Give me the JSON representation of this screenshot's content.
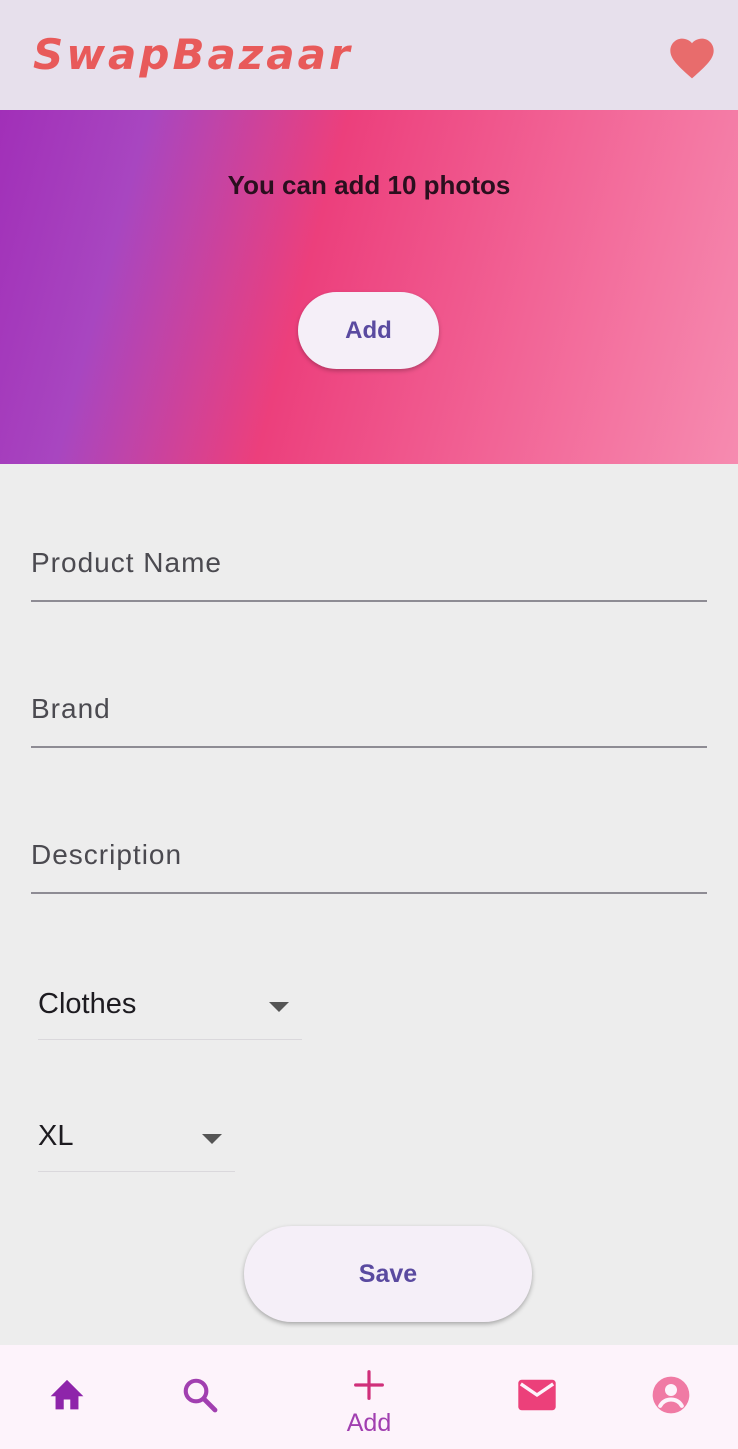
{
  "app": {
    "title": "SwapBazaar"
  },
  "banner": {
    "message": "You can add 10 photos",
    "add_button_label": "Add"
  },
  "form": {
    "product_name_placeholder": "Product Name",
    "brand_placeholder": "Brand",
    "description_placeholder": "Description",
    "category_selected": "Clothes",
    "size_selected": "XL",
    "save_label": "Save"
  },
  "bottom_nav": {
    "add_label": "Add",
    "items": [
      "home-icon",
      "search-icon",
      "add-icon",
      "mail-icon",
      "account-icon"
    ]
  },
  "colors": {
    "brand": "#e85a5a",
    "accent": "#5a4aa0",
    "nav_purple": "#8e24aa",
    "nav_pink": "#ec407a"
  }
}
